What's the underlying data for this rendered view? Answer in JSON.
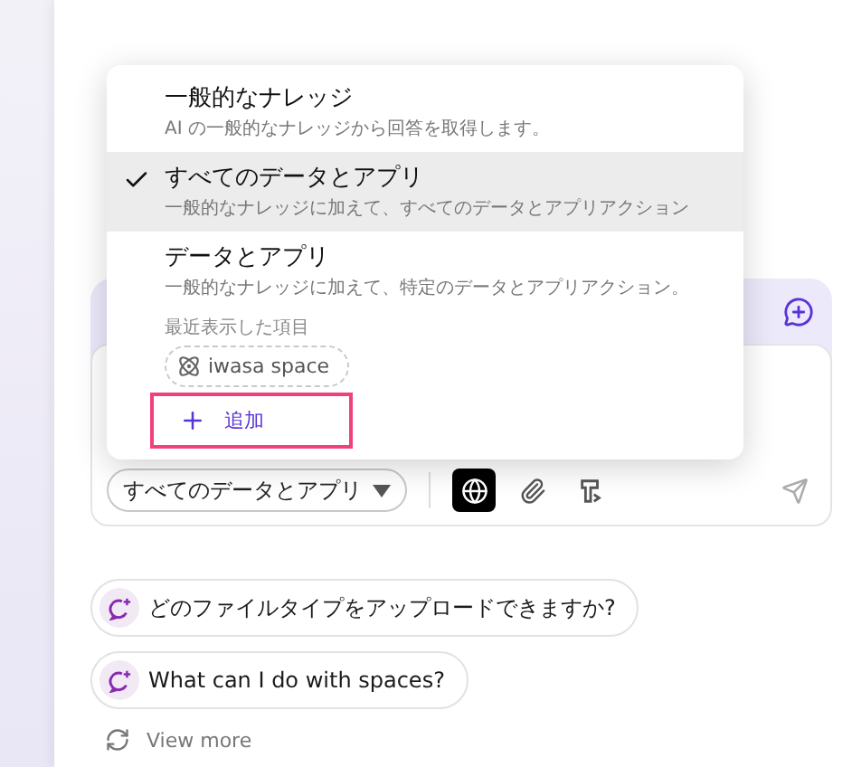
{
  "menu": {
    "items": [
      {
        "title": "一般的なナレッジ",
        "description": "AI の一般的なナレッジから回答を取得します。",
        "selected": false
      },
      {
        "title": "すべてのデータとアプリ",
        "description": "一般的なナレッジに加えて、すべてのデータとアプリアクション",
        "selected": true
      },
      {
        "title": "データとアプリ",
        "description": "一般的なナレッジに加えて、特定のデータとアプリアクション。",
        "selected": false
      }
    ],
    "recent_label": "最近表示した項目",
    "recent": [
      {
        "label": "iwasa space"
      }
    ],
    "add_button": {
      "label": "追加"
    }
  },
  "composer": {
    "mode_select": {
      "label": "すべてのデータとアプリ"
    },
    "tools": [
      {
        "kind": "web",
        "active": true
      },
      {
        "kind": "attach",
        "active": false
      },
      {
        "kind": "prompt",
        "active": false
      }
    ]
  },
  "suggestions": [
    {
      "label": "どのファイルタイプをアップロードできますか?"
    },
    {
      "label": "What can I do with spaces?"
    }
  ],
  "view_more": {
    "label": "View more"
  }
}
